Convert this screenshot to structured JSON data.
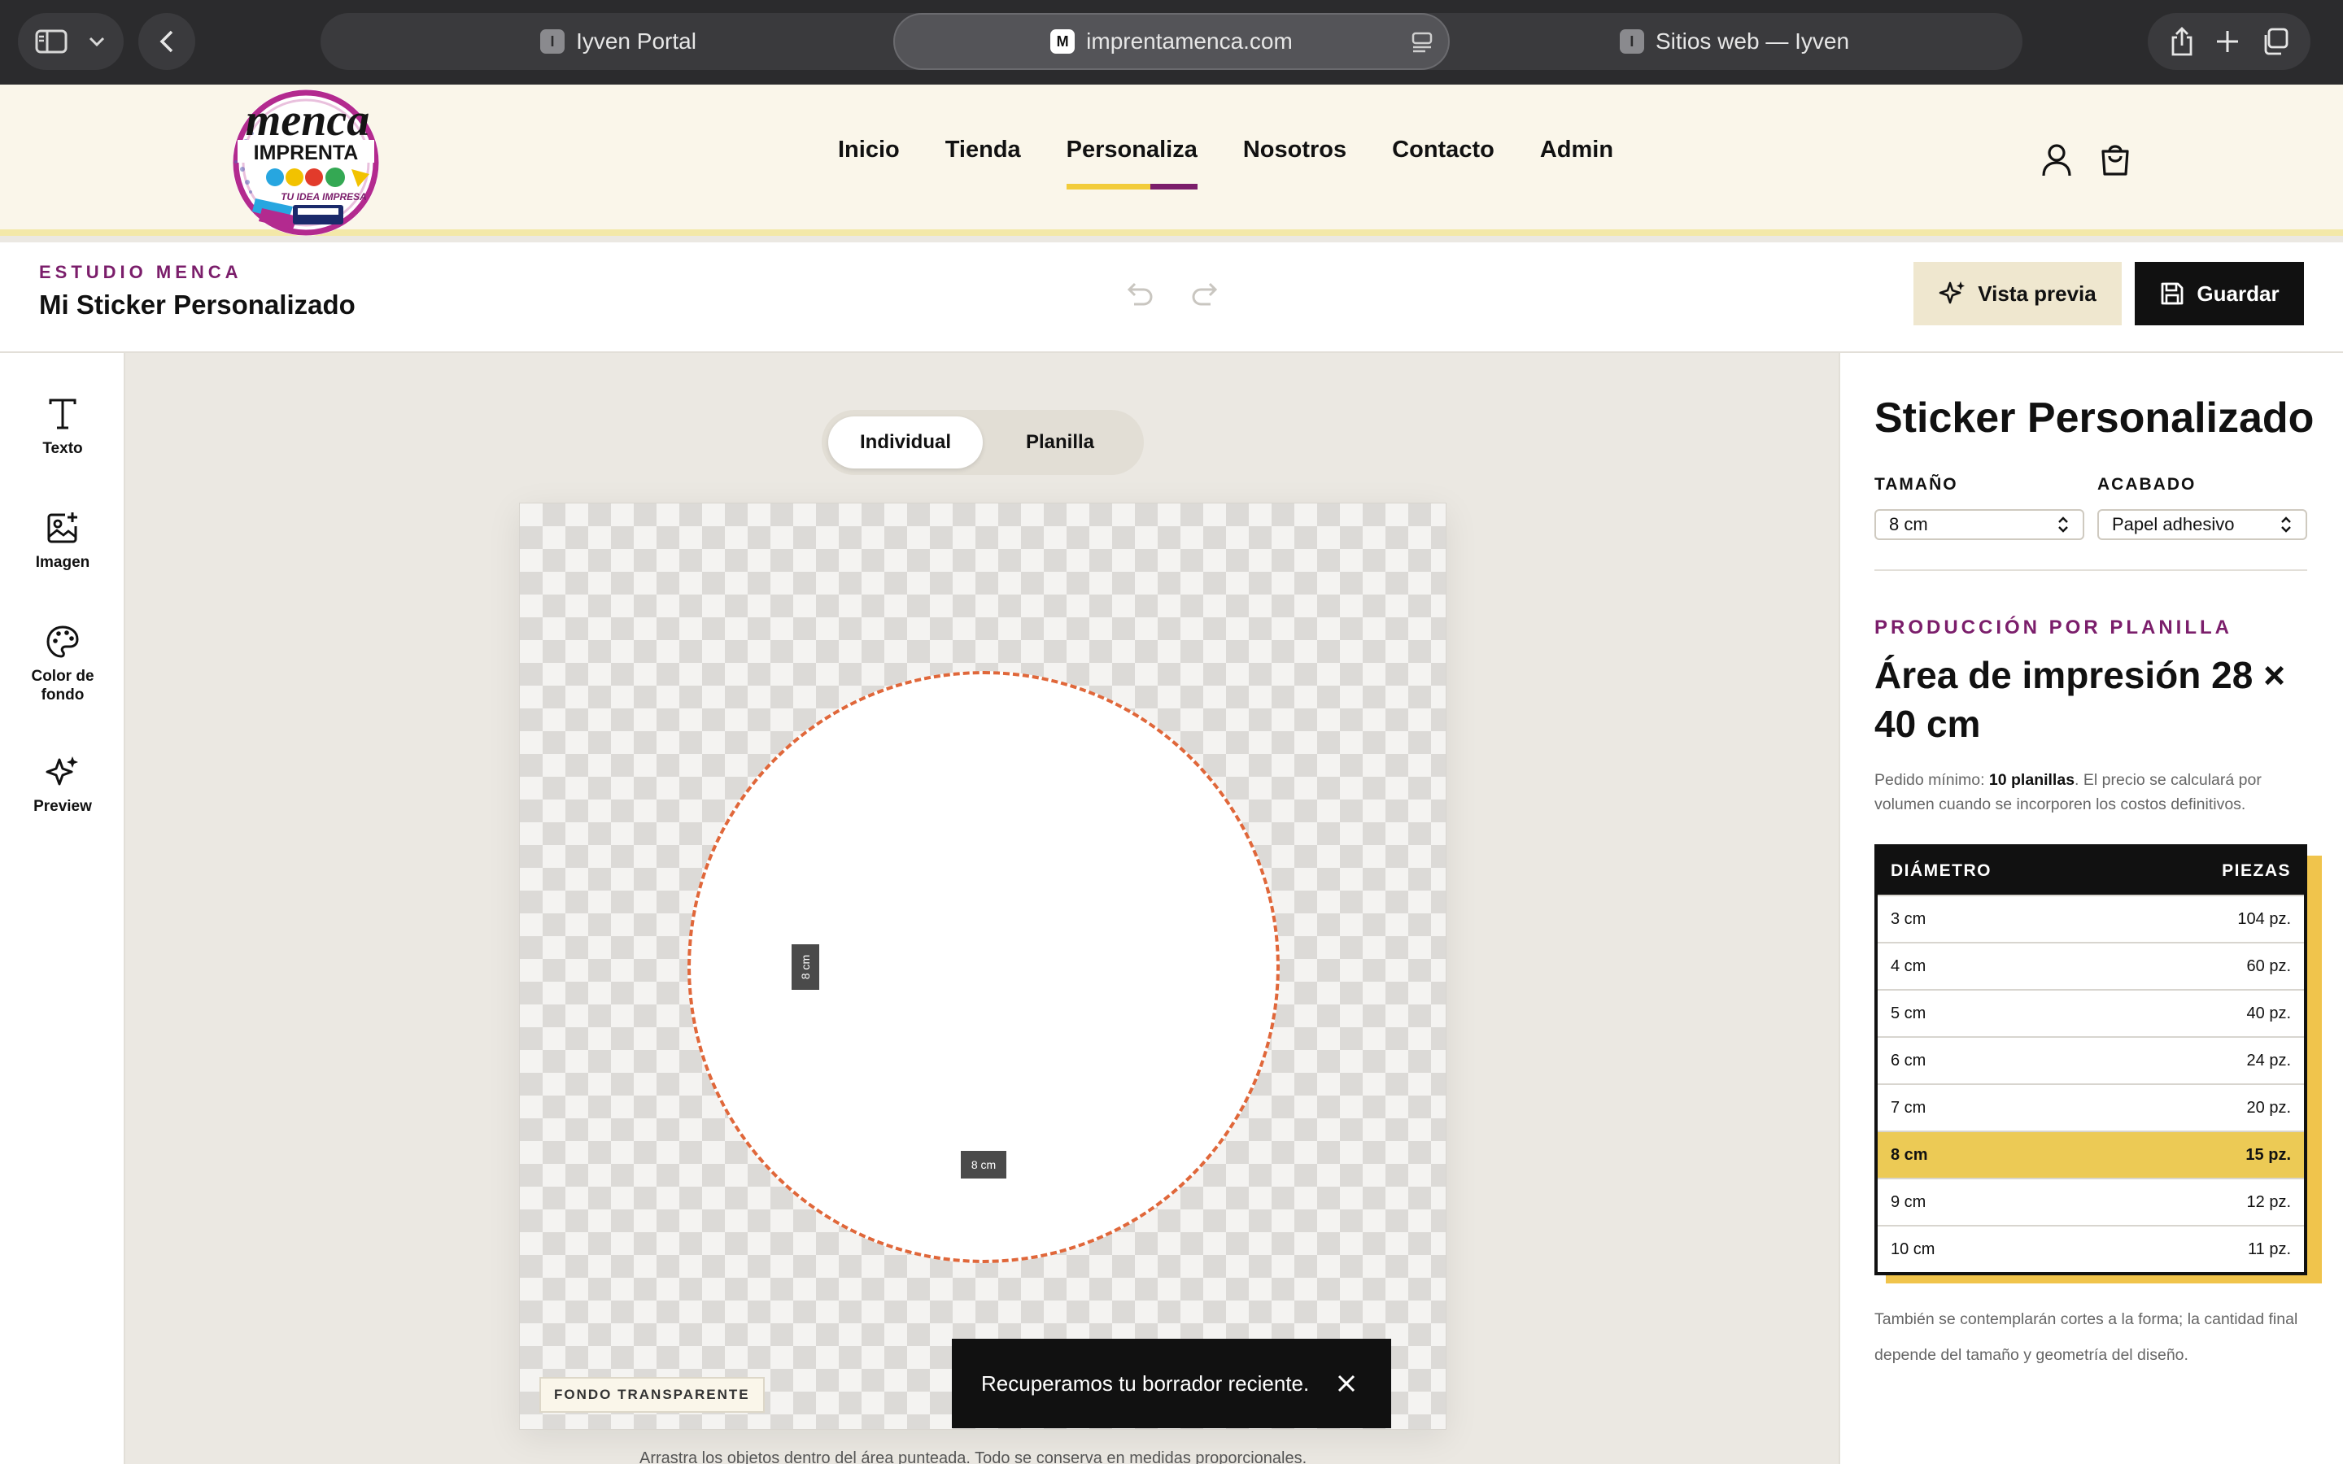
{
  "browser": {
    "tabs": [
      {
        "label": "Iyven Portal",
        "favicon": "I"
      },
      {
        "label": "imprentamenca.com",
        "favicon": "M"
      },
      {
        "label": "Sitios web — Iyven",
        "favicon": "I"
      }
    ]
  },
  "site": {
    "logo": {
      "word": "menca",
      "band": "IMPRENTA",
      "tagline": "TU IDEA IMPRESA"
    },
    "nav": [
      "Inicio",
      "Tienda",
      "Personaliza",
      "Nosotros",
      "Contacto",
      "Admin"
    ],
    "nav_active": "Personaliza"
  },
  "studio": {
    "kicker": "ESTUDIO MENCA",
    "title": "Mi Sticker Personalizado",
    "preview_label": "Vista previa",
    "save_label": "Guardar"
  },
  "toolbar": {
    "items": [
      "Texto",
      "Imagen",
      "Color de fondo",
      "Preview"
    ]
  },
  "canvas": {
    "modes": [
      "Individual",
      "Planilla"
    ],
    "active_mode": "Individual",
    "dim_vertical": "8 cm",
    "dim_horizontal": "8 cm",
    "background_badge": "FONDO TRANSPARENTE",
    "toast": "Recuperamos tu borrador reciente.",
    "hint": "Arrastra los objetos dentro del área punteada. Todo se conserva en medidas proporcionales."
  },
  "panel": {
    "title": "Sticker Personalizado",
    "size_label": "TAMAÑO",
    "size_value": "8 cm",
    "finish_label": "ACABADO",
    "finish_value": "Papel adhesivo",
    "production_kicker": "PRODUCCIÓN POR PLANILLA",
    "area_title": "Área de impresión 28 × 40 cm",
    "note_prefix": "Pedido mínimo: ",
    "note_bold": "10 planillas",
    "note_suffix": ". El precio se calculará por volumen cuando se incorporen los costos definitivos.",
    "table": {
      "headers": [
        "DIÁMETRO",
        "PIEZAS"
      ],
      "rows": [
        [
          "3 cm",
          "104 pz."
        ],
        [
          "4 cm",
          "60 pz."
        ],
        [
          "5 cm",
          "40 pz."
        ],
        [
          "6 cm",
          "24 pz."
        ],
        [
          "7 cm",
          "20 pz."
        ],
        [
          "8 cm",
          "15 pz."
        ],
        [
          "9 cm",
          "12 pz."
        ],
        [
          "10 cm",
          "11 pz."
        ]
      ],
      "selected": "8 cm"
    },
    "footer": "También se contemplarán cortes a la forma; la cantidad final depende del tamaño y geometría del diseño."
  },
  "colors": {
    "accent_purple": "#7b1e6b",
    "accent_yellow": "#ecca55",
    "cut_line": "#e0673a"
  }
}
